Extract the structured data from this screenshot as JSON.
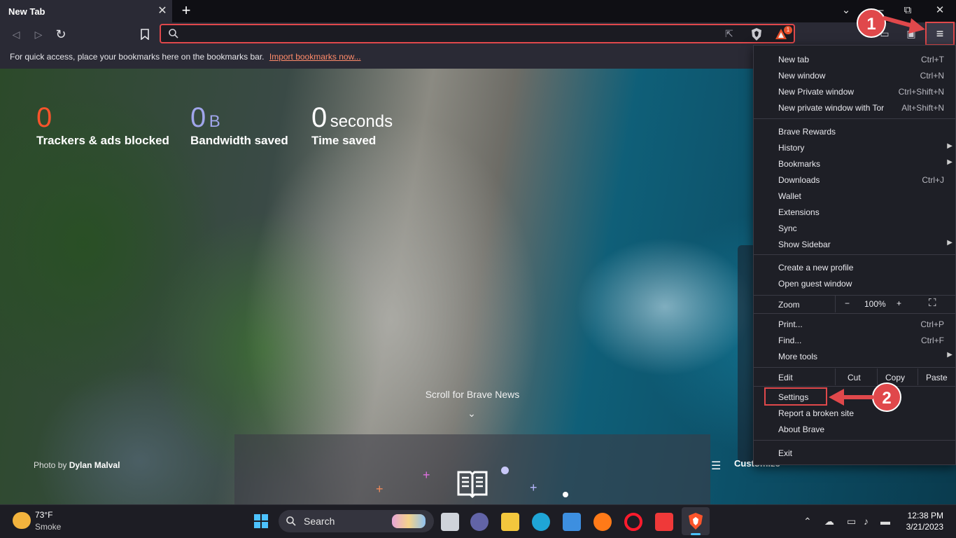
{
  "tab": {
    "title": "New Tab",
    "close": "✕",
    "new": "+"
  },
  "window": {
    "minimize": "⌄",
    "restore": "⧉",
    "close": "✕"
  },
  "toolbar": {
    "back": "◁",
    "forward": "▷",
    "reload": "↻",
    "bookmark": "▯",
    "menu": "≡",
    "rewards_badge": "1",
    "share": "⇱"
  },
  "bookmarks_bar": {
    "text": "For quick access, place your bookmarks here on the bookmarks bar.",
    "link": "Import bookmarks now..."
  },
  "stats": {
    "trackers": {
      "value": "0",
      "label": "Trackers & ads blocked"
    },
    "bandwidth": {
      "value": "0",
      "unit": "B",
      "label": "Bandwidth saved"
    },
    "time": {
      "value": "0",
      "unit": "seconds",
      "label": "Time saved"
    }
  },
  "scroll_news": "Scroll for Brave News",
  "photo_credit": {
    "prefix": "Photo by",
    "author": "Dylan Malval"
  },
  "customize": "Customize",
  "menu": {
    "groups": [
      [
        {
          "label": "New tab",
          "shortcut": "Ctrl+T"
        },
        {
          "label": "New window",
          "shortcut": "Ctrl+N"
        },
        {
          "label": "New Private window",
          "shortcut": "Ctrl+Shift+N"
        },
        {
          "label": "New private window with Tor",
          "shortcut": "Alt+Shift+N"
        }
      ],
      [
        {
          "label": "Brave Rewards",
          "shortcut": ""
        },
        {
          "label": "History",
          "shortcut": "",
          "submenu": true
        },
        {
          "label": "Bookmarks",
          "shortcut": "",
          "submenu": true
        },
        {
          "label": "Downloads",
          "shortcut": "Ctrl+J"
        },
        {
          "label": "Wallet",
          "shortcut": ""
        },
        {
          "label": "Extensions",
          "shortcut": ""
        },
        {
          "label": "Sync",
          "shortcut": ""
        },
        {
          "label": "Show Sidebar",
          "shortcut": "",
          "submenu": true
        }
      ],
      [
        {
          "label": "Create a new profile",
          "shortcut": ""
        },
        {
          "label": "Open guest window",
          "shortcut": ""
        }
      ]
    ],
    "zoom": {
      "label": "Zoom",
      "minus": "−",
      "value": "100%",
      "plus": "+",
      "fullscreen": "⛶"
    },
    "group4": [
      {
        "label": "Print...",
        "shortcut": "Ctrl+P"
      },
      {
        "label": "Find...",
        "shortcut": "Ctrl+F"
      },
      {
        "label": "More tools",
        "shortcut": "",
        "submenu": true
      }
    ],
    "edit": {
      "label": "Edit",
      "cut": "Cut",
      "copy": "Copy",
      "paste": "Paste"
    },
    "group6": [
      {
        "label": "Settings",
        "shortcut": ""
      },
      {
        "label": "Report a broken site",
        "shortcut": ""
      },
      {
        "label": "About Brave",
        "shortcut": ""
      }
    ],
    "exit": "Exit"
  },
  "annotations": {
    "step1": "1",
    "step2": "2"
  },
  "taskbar": {
    "weather": {
      "temp": "73°F",
      "desc": "Smoke"
    },
    "search": "Search",
    "clock": {
      "time": "12:38 PM",
      "date": "3/21/2023"
    }
  },
  "colors": {
    "accent_red": "#e0484b",
    "brave_orange": "#fb542b",
    "bandwidth_purple": "#a0a5eb"
  }
}
